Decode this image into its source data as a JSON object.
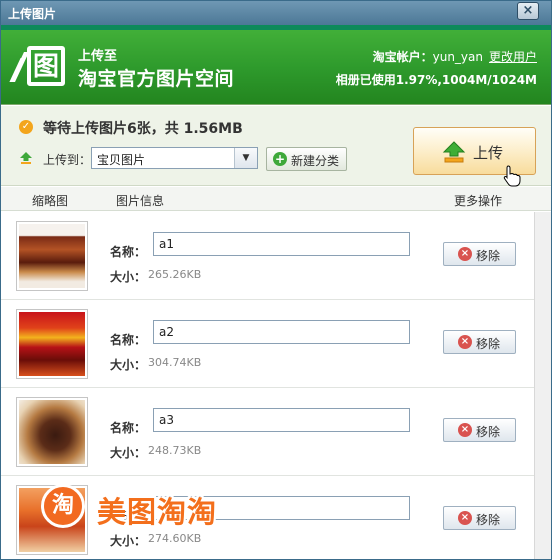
{
  "window": {
    "title": "上传图片",
    "close_glyph": "×"
  },
  "banner": {
    "logo_glyph": "图",
    "subtitle": "上传至",
    "title": "淘宝官方图片空间",
    "account_label": "淘宝帐户：",
    "account_user": "yun_yan",
    "change_user_link": "更改用户",
    "usage_text": "相册已使用1.97%,1004M/1024M"
  },
  "status": {
    "pending_text": "等待上传图片6张，共 1.56MB",
    "upload_to_label": "上传到：",
    "category_value": "宝贝图片",
    "new_category_label": "新建分类",
    "upload_button_label": "上传"
  },
  "columns": {
    "thumbnail": "缩略图",
    "info": "图片信息",
    "more": "更多操作"
  },
  "labels": {
    "name": "名称：",
    "size": "大小：",
    "remove": "移除"
  },
  "files": [
    {
      "name": "a1",
      "size": "265.26KB"
    },
    {
      "name": "a2",
      "size": "304.74KB"
    },
    {
      "name": "a3",
      "size": "248.73KB"
    },
    {
      "name": "",
      "size": "274.60KB"
    }
  ],
  "watermark": {
    "mark": "淘",
    "text": "美图淘淘"
  },
  "colors": {
    "banner_green": "#2e9a2c",
    "upload_orange": "#f8dc9c",
    "watermark_orange": "#f36f1c"
  },
  "icons": {
    "status": "check-circle-icon",
    "upload_to": "upload-arrow-icon",
    "new_category": "plus-circle-icon",
    "upload_button": "upload-arrow-icon",
    "remove": "remove-x-icon",
    "cursor": "hand-pointer-icon"
  }
}
